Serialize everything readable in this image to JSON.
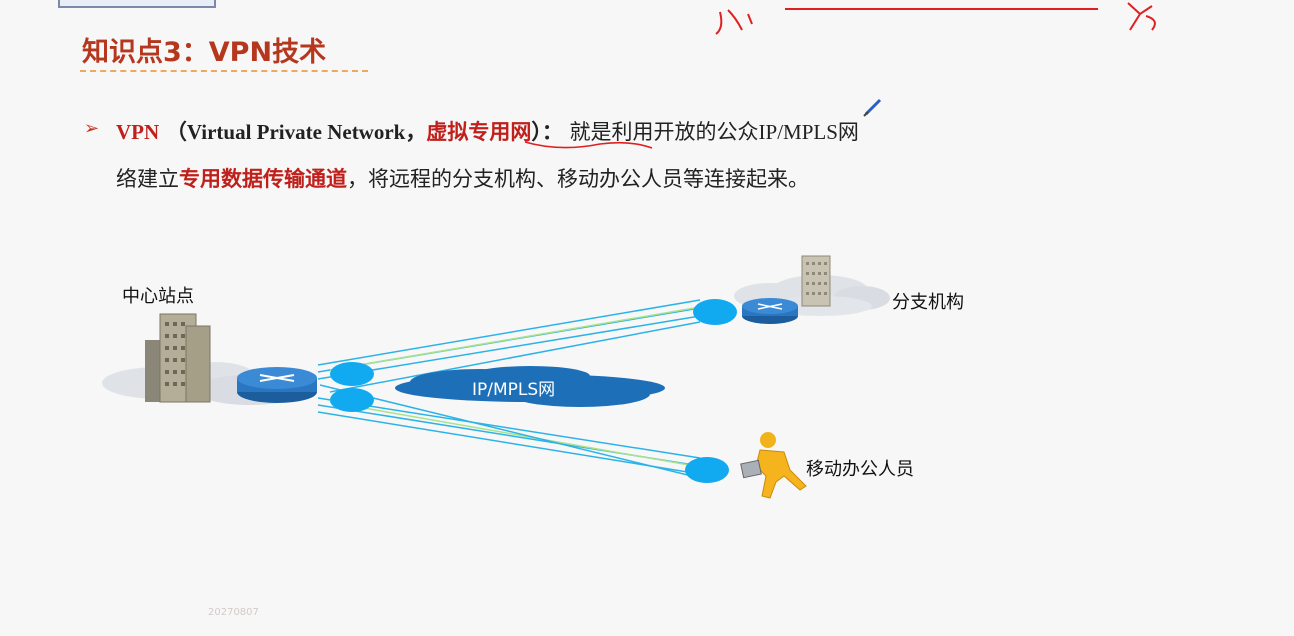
{
  "slide": {
    "title": "知识点3：VPN技术",
    "bullet_marker": "➢",
    "line1": {
      "vpn": "VPN",
      "paren_open_en": "（Virtual Private Network，",
      "highlight": "虚拟专用网",
      "paren_close": "）：",
      "text_a": "就是利用开放的公众",
      "ipmpls": "IP/MPLS",
      "text_b": "网"
    },
    "line2": {
      "text_a": "络建立",
      "highlight": "专用数据传输通道",
      "text_b": "，将远程的分支机构、移动办公人员等连接起来。"
    },
    "diagram": {
      "center_site": "中心站点",
      "branch": "分支机构",
      "mobile": "移动办公人员",
      "cloud": "IP/MPLS网"
    },
    "watermark": "20270807"
  },
  "colors": {
    "title": "#b5371d",
    "highlight": "#c0201b",
    "cloud": "#1d6fb8",
    "tunnel": "#2bb3e8",
    "annotation_pen": "#e02020"
  },
  "icons": [
    "building-icon",
    "router-icon",
    "cloud-icon",
    "person-icon",
    "pen-icon",
    "tunnel-endpoint-icon"
  ]
}
